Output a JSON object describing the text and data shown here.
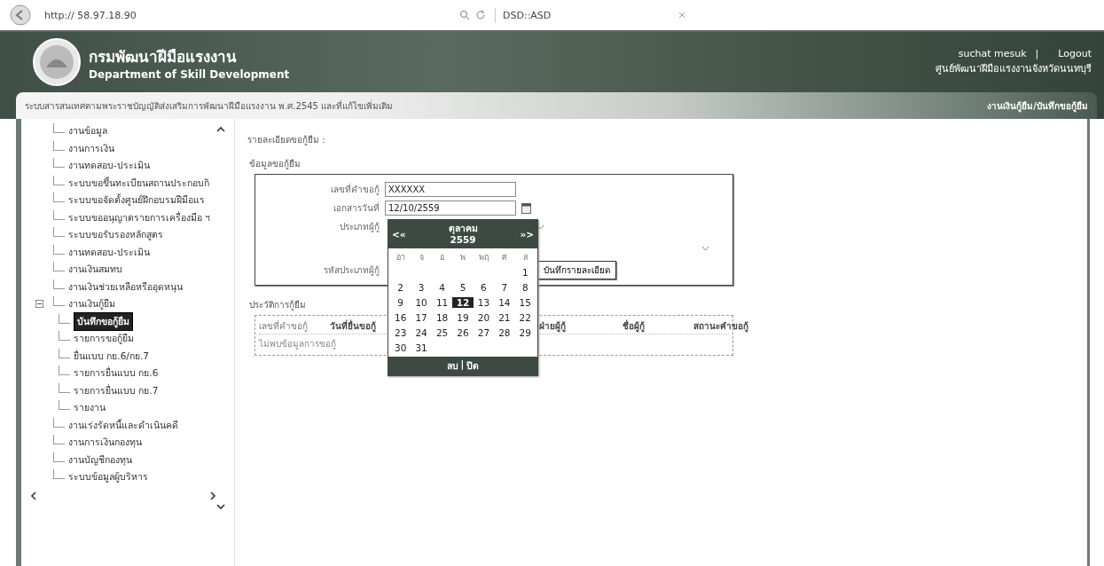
{
  "browser": {
    "address": "http:// 58.97.18.90",
    "tab_title": "DSD::ASD"
  },
  "header": {
    "title_th": "กรมพัฒนาฝีมือแรงงาน",
    "title_en": "Department of Skill Development",
    "user": "suchat mesuk",
    "separator": "|",
    "logout": "Logout",
    "office": "ศูนย์พัฒนาฝีมือแรงงานจังหวัดนนทบุรี"
  },
  "subheader": {
    "system": "ระบบสารสนเทศตามพระราชบัญญัติส่งเสริมการพัฒนาฝีมือแรงงาน พ.ศ.2545 และที่แก้ไขเพิ่มเติม",
    "breadcrumb": "งานเงินกู้ยืม/บันทึกขอกู้ยืม"
  },
  "sidebar": {
    "items": [
      {
        "label": "งานข้อมูล",
        "selected": false
      },
      {
        "label": "งานการเงิน",
        "selected": false
      },
      {
        "label": "งานทดสอบ-ประเมิน",
        "selected": false
      },
      {
        "label": "ระบบขอขึ้นทะเบียนสถานประกอบกิ",
        "selected": false
      },
      {
        "label": "ระบบขอจัดตั้งศูนย์ฝึกอบรมฝีมือแร",
        "selected": false
      },
      {
        "label": "ระบบขออนุญาตรายการเครื่องมือ ฯ",
        "selected": false
      },
      {
        "label": "ระบบขอรับรองหลักสูตร",
        "selected": false
      },
      {
        "label": "งานทดสอบ-ประเมิน",
        "selected": false
      },
      {
        "label": "งานเงินสมทบ",
        "selected": false
      },
      {
        "label": "งานเงินช่วยเหลือหรืออุดหนุน",
        "selected": false
      },
      {
        "label": "งานเงินกู้ยืม",
        "selected": false,
        "expanded": true,
        "children": [
          {
            "label": "บันทึกขอกู้ยืม",
            "selected": true
          },
          {
            "label": "รายการขอกู้ยืม",
            "selected": false
          },
          {
            "label": "ยื่นแบบ กย.6/กย.7",
            "selected": false
          },
          {
            "label": "รายการยื่นแบบ กย.6",
            "selected": false
          },
          {
            "label": "รายการยื่นแบบ กย.7",
            "selected": false
          },
          {
            "label": "รายงาน",
            "selected": false
          }
        ]
      },
      {
        "label": "งานเร่งรัดหนี้และดำเนินคดี",
        "selected": false
      },
      {
        "label": "งานการเงินกองทุน",
        "selected": false
      },
      {
        "label": "งานบัญชีกองทุน",
        "selected": false
      },
      {
        "label": "ระบบข้อมูลผู้บริหาร",
        "selected": false
      }
    ]
  },
  "content": {
    "title": "รายละเอียดขอกู้ยืม :",
    "form": {
      "legend": "ข้อมูลขอกู้ยืม",
      "fields": [
        {
          "kind": "text",
          "label": "เลขที่คำขอกู้",
          "value": "XXXXXX"
        },
        {
          "kind": "date",
          "label": "เอกสารวันที่",
          "value": "12/10/2559"
        },
        {
          "kind": "select",
          "label": "ประเภทผู้กู้"
        },
        {
          "kind": "select"
        },
        {
          "kind": "button",
          "label": "รหัสประเภทผู้กู้",
          "button": "บันทึกรายละเอียด"
        }
      ]
    },
    "calendar": {
      "prev": "<«",
      "next": "»>",
      "month": "ตุลาคม",
      "year": "2559",
      "weekdays": [
        "อา",
        "จ",
        "อ",
        "พ",
        "พฤ",
        "ศ",
        "ส"
      ],
      "weeks": [
        [
          {
            "label": "1",
            "selected": false
          }
        ],
        [
          {
            "label": "2",
            "selected": false
          },
          {
            "label": "3",
            "selected": false
          },
          {
            "label": "4",
            "selected": false
          },
          {
            "label": "5",
            "selected": false
          },
          {
            "label": "6",
            "selected": false
          },
          {
            "label": "7",
            "selected": false
          },
          {
            "label": "8",
            "selected": false
          }
        ],
        [
          {
            "label": "9",
            "selected": false
          },
          {
            "label": "10",
            "selected": false
          },
          {
            "label": "11",
            "selected": false
          },
          {
            "label": "12",
            "selected": true
          },
          {
            "label": "13",
            "selected": false
          },
          {
            "label": "14",
            "selected": false
          },
          {
            "label": "15",
            "selected": false
          }
        ],
        [
          {
            "label": "16",
            "selected": false
          },
          {
            "label": "17",
            "selected": false
          },
          {
            "label": "18",
            "selected": false
          },
          {
            "label": "19",
            "selected": false
          },
          {
            "label": "20",
            "selected": false
          },
          {
            "label": "21",
            "selected": false
          },
          {
            "label": "22",
            "selected": false
          }
        ],
        [
          {
            "label": "23",
            "selected": false
          },
          {
            "label": "24",
            "selected": false
          },
          {
            "label": "25",
            "selected": false
          },
          {
            "label": "26",
            "selected": false
          },
          {
            "label": "27",
            "selected": false
          },
          {
            "label": "28",
            "selected": false
          },
          {
            "label": "29",
            "selected": false
          }
        ],
        [
          {
            "label": "30",
            "selected": false
          },
          {
            "label": "31",
            "selected": false
          }
        ]
      ],
      "clear": "ลบ",
      "divider": "|",
      "close": "ปิด"
    },
    "history": {
      "legend": "ประวัติการกู้ยืม",
      "columns": [
        "เลขที่คำขอกู้",
        "วันที่ยื่นขอกู้",
        "ฝ่ายผู้กู้",
        "ชื่อผู้กู้",
        "สถานะคำขอกู้"
      ],
      "empty": "ไม่พบข้อมูลการขอกู้"
    }
  }
}
